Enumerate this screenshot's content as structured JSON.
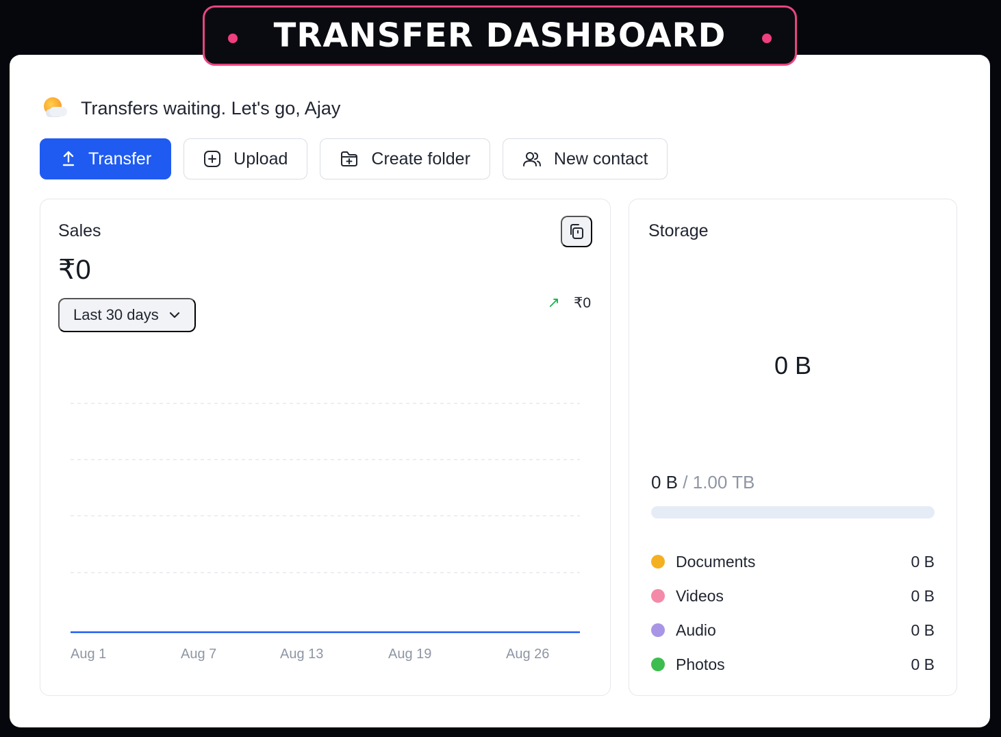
{
  "banner": {
    "title": "TRANSFER DASHBOARD"
  },
  "greeting": {
    "icon": "sun-behind-cloud-icon",
    "text": "Transfers waiting. Let's go, Ajay"
  },
  "actions": [
    {
      "label": "Transfer",
      "icon": "upload-arrow-icon",
      "primary": true
    },
    {
      "label": "Upload",
      "icon": "plus-square-icon"
    },
    {
      "label": "Create folder",
      "icon": "folder-plus-icon"
    },
    {
      "label": "New contact",
      "icon": "users-icon"
    }
  ],
  "sales": {
    "title": "Sales",
    "amount": "₹0",
    "range": "Last 30 days",
    "delta": "₹0",
    "delta_icon": "arrow-up-right-icon",
    "accent": "#1f5bf0"
  },
  "chart_data": {
    "type": "line",
    "categories": [
      "Aug 1",
      "Aug 7",
      "Aug 13",
      "Aug 19",
      "Aug 26"
    ],
    "x_ticks": [
      "Aug 1",
      "Aug 7",
      "Aug 13",
      "Aug 19",
      "Aug 26"
    ],
    "series": [
      {
        "values": [
          0,
          0,
          0,
          0,
          0
        ],
        "color": "#1f5bf0"
      }
    ],
    "grid": true,
    "ylim": [
      0,
      1
    ]
  },
  "storage": {
    "title": "Storage",
    "total_display": "0 B",
    "used": "0 B",
    "separator": "/",
    "capacity": "1.00 TB",
    "used_fraction": 0,
    "categories": [
      {
        "name": "Documents",
        "value": "0 B",
        "color": "#f5b021"
      },
      {
        "name": "Videos",
        "value": "0 B",
        "color": "#f48aa8"
      },
      {
        "name": "Audio",
        "value": "0 B",
        "color": "#a995e6"
      },
      {
        "name": "Photos",
        "value": "0 B",
        "color": "#3dbd4f"
      }
    ]
  }
}
